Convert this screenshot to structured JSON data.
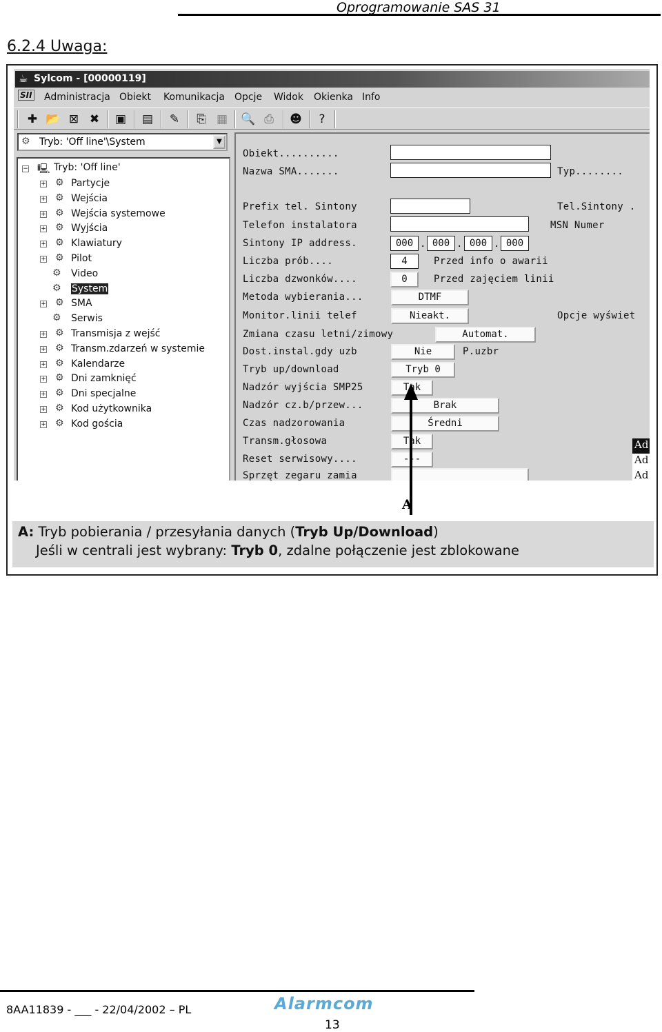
{
  "header": {
    "title": "Oprogramowanie SAS 31"
  },
  "section_heading": "6.2.4 Uwaga:",
  "app": {
    "title": "Sylcom - [00000119]",
    "menu": [
      "Administracja",
      "Obiekt",
      "Komunikacja",
      "Opcje",
      "Widok",
      "Okienka",
      "Info"
    ],
    "toolbar_icons": [
      "add-icon",
      "open-folder-icon",
      "disconnect-icon",
      "delete-icon",
      "save-icon",
      "properties-icon",
      "edit-icon",
      "copy-icon",
      "paste-icon",
      "print-preview-icon",
      "print-icon",
      "user-icon",
      "help-icon"
    ],
    "mode_combo": "Tryb: 'Off line'\\System",
    "tree": {
      "root": "Tryb: 'Off line'",
      "items": [
        {
          "label": "Partycje",
          "expandable": true
        },
        {
          "label": "Wejścia",
          "expandable": true
        },
        {
          "label": "Wejścia systemowe",
          "expandable": true
        },
        {
          "label": "Wyjścia",
          "expandable": true
        },
        {
          "label": "Klawiatury",
          "expandable": true
        },
        {
          "label": "Pilot",
          "expandable": true
        },
        {
          "label": "Video",
          "expandable": false
        },
        {
          "label": "System",
          "expandable": false,
          "selected": true
        },
        {
          "label": "SMA",
          "expandable": true
        },
        {
          "label": "Serwis",
          "expandable": false
        },
        {
          "label": "Transmisja z wejść",
          "expandable": true
        },
        {
          "label": "Transm.zdarzeń w systemie",
          "expandable": true
        },
        {
          "label": "Kalendarze",
          "expandable": true
        },
        {
          "label": "Dni zamknięć",
          "expandable": true
        },
        {
          "label": "Dni specjalne",
          "expandable": true
        },
        {
          "label": "Kod użytkownika",
          "expandable": true
        },
        {
          "label": "Kod gościa",
          "expandable": true
        }
      ]
    },
    "form": {
      "labels": [
        "Obiekt..........",
        "Nazwa SMA.......",
        "Prefix tel. Sintony",
        "Telefon instalatora",
        "Sintony IP address.",
        "Liczba prób....",
        "Liczba dzwonków....",
        "Metoda wybierania...",
        "Monitor.linii telef",
        "Zmiana czasu letni/zimowy",
        "Dost.instal.gdy uzb",
        "Tryb up/download",
        "Nadzór wyjścia SMP25",
        "Nadzór cz.b/przew...",
        "Czas nadzorowania",
        "Transm.głosowa",
        "Reset serwisowy....",
        "Sprzęt zegaru zamia"
      ],
      "side_labels": [
        "Typ........",
        "Tel.Sintony .",
        "MSN Numer",
        "Przed info o awarii",
        "Przed zajęciem linii",
        "Opcje wyświet",
        "P.uzbr"
      ],
      "obiekt": "",
      "nazwa_sma": "",
      "prefix": "",
      "telefon": "",
      "ip": [
        "000",
        "000",
        "000",
        "000"
      ],
      "liczba_prob": "4",
      "liczba_dzwonkow": "0",
      "metoda": "DTMF",
      "monitor": "Nieakt.",
      "zmiana_czasu": "Automat.",
      "dost_instal": "Nie",
      "tryb_updown": "Tryb 0",
      "nadzor_smp25": "Tak",
      "nadzor_czb": "Brak",
      "czas_nadzor": "Średni",
      "transm_glos": "Tak",
      "reset_serw": "---",
      "list_items": [
        "Ad",
        "Ad",
        "Ad"
      ]
    }
  },
  "annotation_label": "A",
  "caption": {
    "line1_prefix": "A:",
    "line1_text": " Tryb pobierania / przesyłania danych (",
    "line1_bold": "Tryb Up/Download",
    "line1_end": ")",
    "line2_text": "Jeśli w centrali jest wybrany: ",
    "line2_bold": "Tryb 0",
    "line2_end": ", zdalne połączenie jest zblokowane"
  },
  "footer": {
    "doc_ref": "8AA11839 - ___ - 22/04/2002 – PL",
    "logo": "Alarmcom",
    "page": "13"
  }
}
